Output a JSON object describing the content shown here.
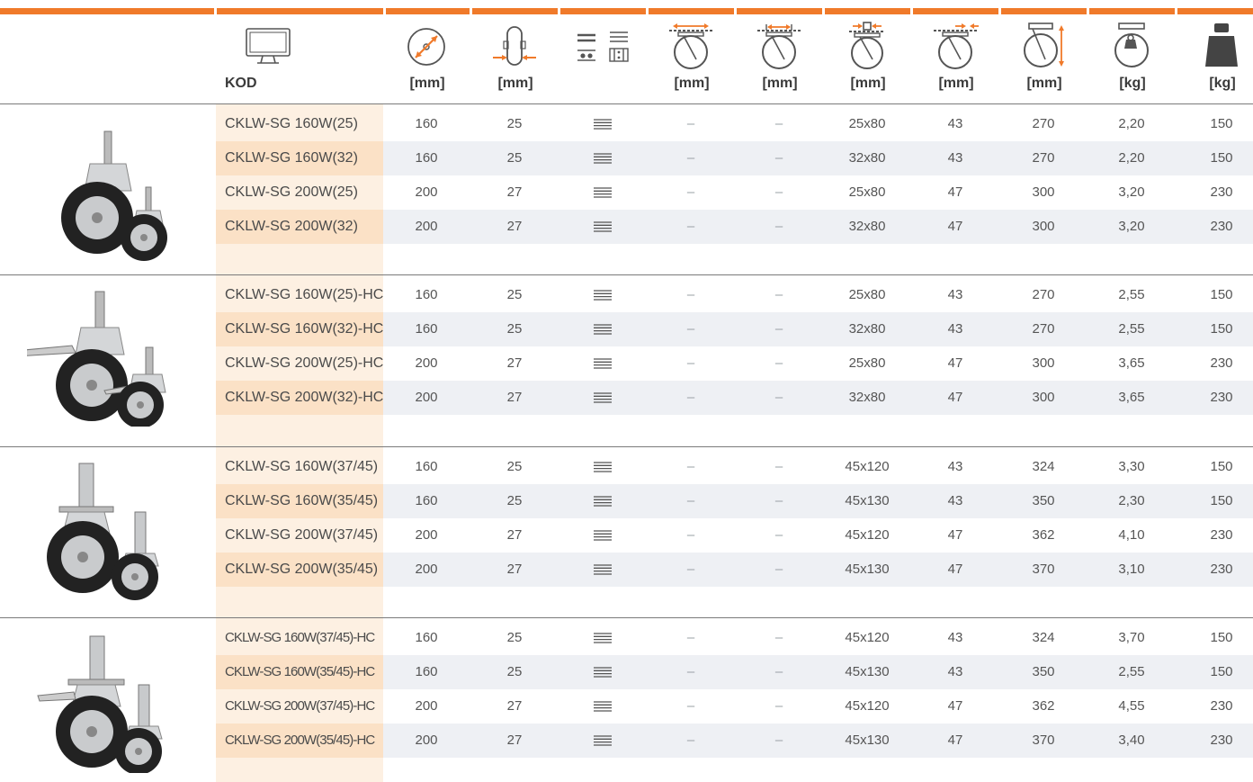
{
  "header": {
    "icons": [
      "monitor-icon",
      "wheel-diameter-icon",
      "wheel-width-icon",
      "tread-profile-icon",
      "plate-size-icon",
      "hole-spacing-icon",
      "stem-size-icon",
      "offset-icon",
      "overall-height-icon",
      "weight-icon",
      "load-capacity-icon"
    ],
    "code_label": "KOD",
    "units": [
      "[mm]",
      "[mm]",
      "",
      "[mm]",
      "[mm]",
      "[mm]",
      "[mm]",
      "[mm]",
      "[kg]",
      "[kg]"
    ]
  },
  "colors": {
    "accent": "#f07a2a",
    "kod_column": "#fdf0e2",
    "kod_shade": "#fbe1c6",
    "row_shade": "#eef0f4"
  },
  "groups": [
    {
      "image": "caster-swivel-stem",
      "rows": [
        {
          "code": "CKLW-SG 160W(25)",
          "d": "160",
          "w": "25",
          "tread": "lines-icon",
          "a": "–",
          "b": "–",
          "stem": "25x80",
          "offset": "43",
          "h": "270",
          "kg": "2,20",
          "load": "150"
        },
        {
          "code": "CKLW-SG 160W(32)",
          "d": "160",
          "w": "25",
          "tread": "lines-icon",
          "a": "–",
          "b": "–",
          "stem": "32x80",
          "offset": "43",
          "h": "270",
          "kg": "2,20",
          "load": "150"
        },
        {
          "code": "CKLW-SG 200W(25)",
          "d": "200",
          "w": "27",
          "tread": "lines-icon",
          "a": "–",
          "b": "–",
          "stem": "25x80",
          "offset": "47",
          "h": "300",
          "kg": "3,20",
          "load": "230"
        },
        {
          "code": "CKLW-SG 200W(32)",
          "d": "200",
          "w": "27",
          "tread": "lines-icon",
          "a": "–",
          "b": "–",
          "stem": "32x80",
          "offset": "47",
          "h": "300",
          "kg": "3,20",
          "load": "230"
        }
      ]
    },
    {
      "image": "caster-swivel-stem-brake",
      "rows": [
        {
          "code": "CKLW-SG 160W(25)-HC",
          "d": "160",
          "w": "25",
          "tread": "lines-icon",
          "a": "–",
          "b": "–",
          "stem": "25x80",
          "offset": "43",
          "h": "270",
          "kg": "2,55",
          "load": "150"
        },
        {
          "code": "CKLW-SG 160W(32)-HC",
          "d": "160",
          "w": "25",
          "tread": "lines-icon",
          "a": "–",
          "b": "–",
          "stem": "32x80",
          "offset": "43",
          "h": "270",
          "kg": "2,55",
          "load": "150"
        },
        {
          "code": "CKLW-SG 200W(25)-HC",
          "d": "200",
          "w": "27",
          "tread": "lines-icon",
          "a": "–",
          "b": "–",
          "stem": "25x80",
          "offset": "47",
          "h": "300",
          "kg": "3,65",
          "load": "230"
        },
        {
          "code": "CKLW-SG 200W(32)-HC",
          "d": "200",
          "w": "27",
          "tread": "lines-icon",
          "a": "–",
          "b": "–",
          "stem": "32x80",
          "offset": "47",
          "h": "300",
          "kg": "3,65",
          "load": "230"
        }
      ]
    },
    {
      "image": "caster-scaffold-tube",
      "rows": [
        {
          "code": "CKLW-SG 160W(37/45)",
          "d": "160",
          "w": "25",
          "tread": "lines-icon",
          "a": "–",
          "b": "–",
          "stem": "45x120",
          "offset": "43",
          "h": "324",
          "kg": "3,30",
          "load": "150"
        },
        {
          "code": "CKLW-SG 160W(35/45)",
          "d": "160",
          "w": "25",
          "tread": "lines-icon",
          "a": "–",
          "b": "–",
          "stem": "45x130",
          "offset": "43",
          "h": "350",
          "kg": "2,30",
          "load": "150"
        },
        {
          "code": "CKLW-SG 200W(37/45)",
          "d": "200",
          "w": "27",
          "tread": "lines-icon",
          "a": "–",
          "b": "–",
          "stem": "45x120",
          "offset": "47",
          "h": "362",
          "kg": "4,10",
          "load": "230"
        },
        {
          "code": "CKLW-SG 200W(35/45)",
          "d": "200",
          "w": "27",
          "tread": "lines-icon",
          "a": "–",
          "b": "–",
          "stem": "45x130",
          "offset": "47",
          "h": "370",
          "kg": "3,10",
          "load": "230"
        }
      ]
    },
    {
      "image": "caster-scaffold-tube-brake",
      "rows": [
        {
          "code": "CKLW-SG 160W(37/45)-HC",
          "d": "160",
          "w": "25",
          "tread": "lines-icon",
          "a": "–",
          "b": "–",
          "stem": "45x120",
          "offset": "43",
          "h": "324",
          "kg": "3,70",
          "load": "150"
        },
        {
          "code": "CKLW-SG 160W(35/45)-HC",
          "d": "160",
          "w": "25",
          "tread": "lines-icon",
          "a": "–",
          "b": "–",
          "stem": "45x130",
          "offset": "43",
          "h": "350",
          "kg": "2,55",
          "load": "150"
        },
        {
          "code": "CKLW-SG 200W(37/45)-HC",
          "d": "200",
          "w": "27",
          "tread": "lines-icon",
          "a": "–",
          "b": "–",
          "stem": "45x120",
          "offset": "47",
          "h": "362",
          "kg": "4,55",
          "load": "230"
        },
        {
          "code": "CKLW-SG 200W(35/45)-HC",
          "d": "200",
          "w": "27",
          "tread": "lines-icon",
          "a": "–",
          "b": "–",
          "stem": "45x130",
          "offset": "47",
          "h": "370",
          "kg": "3,40",
          "load": "230"
        }
      ]
    }
  ]
}
